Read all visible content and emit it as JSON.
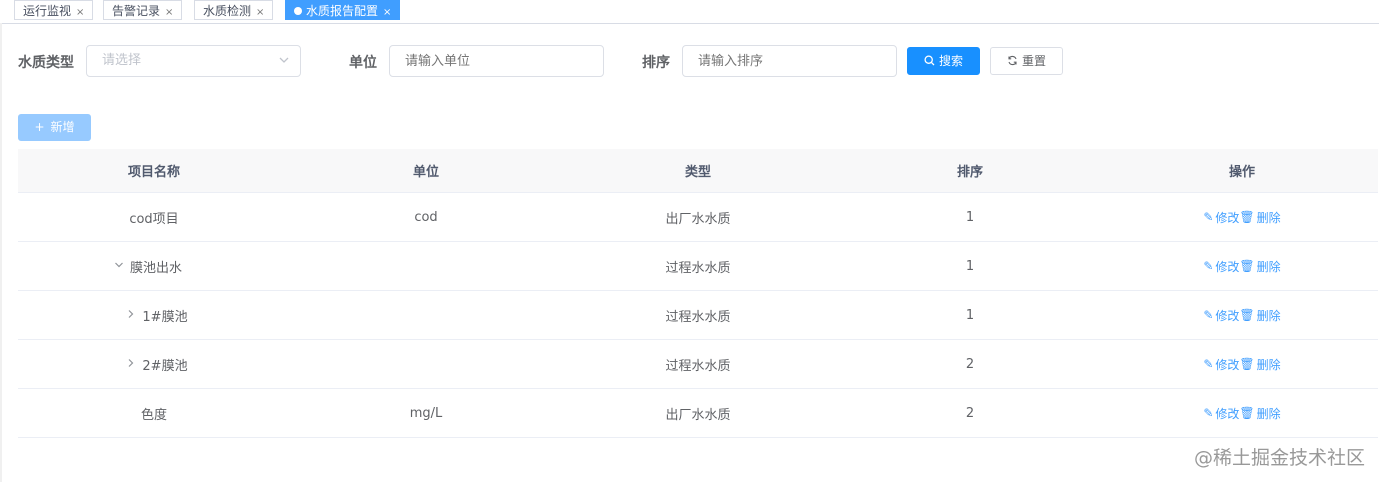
{
  "tags": [
    {
      "label": "运行监视",
      "close": "×"
    },
    {
      "label": "告警记录",
      "close": "×"
    },
    {
      "label": "水质检测",
      "close": "×"
    },
    {
      "label": "水质报告配置",
      "close": "×"
    }
  ],
  "form": {
    "type_label": "水质类型",
    "type_placeholder": "请选择",
    "unit_label": "单位",
    "unit_placeholder": "请输入单位",
    "sort_label": "排序",
    "sort_placeholder": "请输入排序",
    "search_label": "搜索",
    "reset_label": "重置"
  },
  "toolbar": {
    "add_label": "新增",
    "add_icon": "+"
  },
  "table": {
    "headers": [
      "项目名称",
      "单位",
      "类型",
      "排序",
      "操作"
    ],
    "edit_label": "修改",
    "delete_label": "删除",
    "rows": [
      {
        "name": "cod项目",
        "unit": "cod",
        "type": "出厂水水质",
        "sort": "1",
        "tree": "none"
      },
      {
        "name": "膜池出水",
        "unit": "",
        "type": "过程水水质",
        "sort": "1",
        "tree": "expanded"
      },
      {
        "name": "1#膜池",
        "unit": "",
        "type": "过程水水质",
        "sort": "1",
        "tree": "collapsed"
      },
      {
        "name": "2#膜池",
        "unit": "",
        "type": "过程水水质",
        "sort": "2",
        "tree": "collapsed"
      },
      {
        "name": "色度",
        "unit": "mg/L",
        "type": "出厂水水质",
        "sort": "2",
        "tree": "none"
      }
    ]
  },
  "watermark": "@稀土掘金技术社区",
  "colors": {
    "primary": "#1890ff",
    "link": "#409eff",
    "header_bg": "#f8f8f9"
  }
}
